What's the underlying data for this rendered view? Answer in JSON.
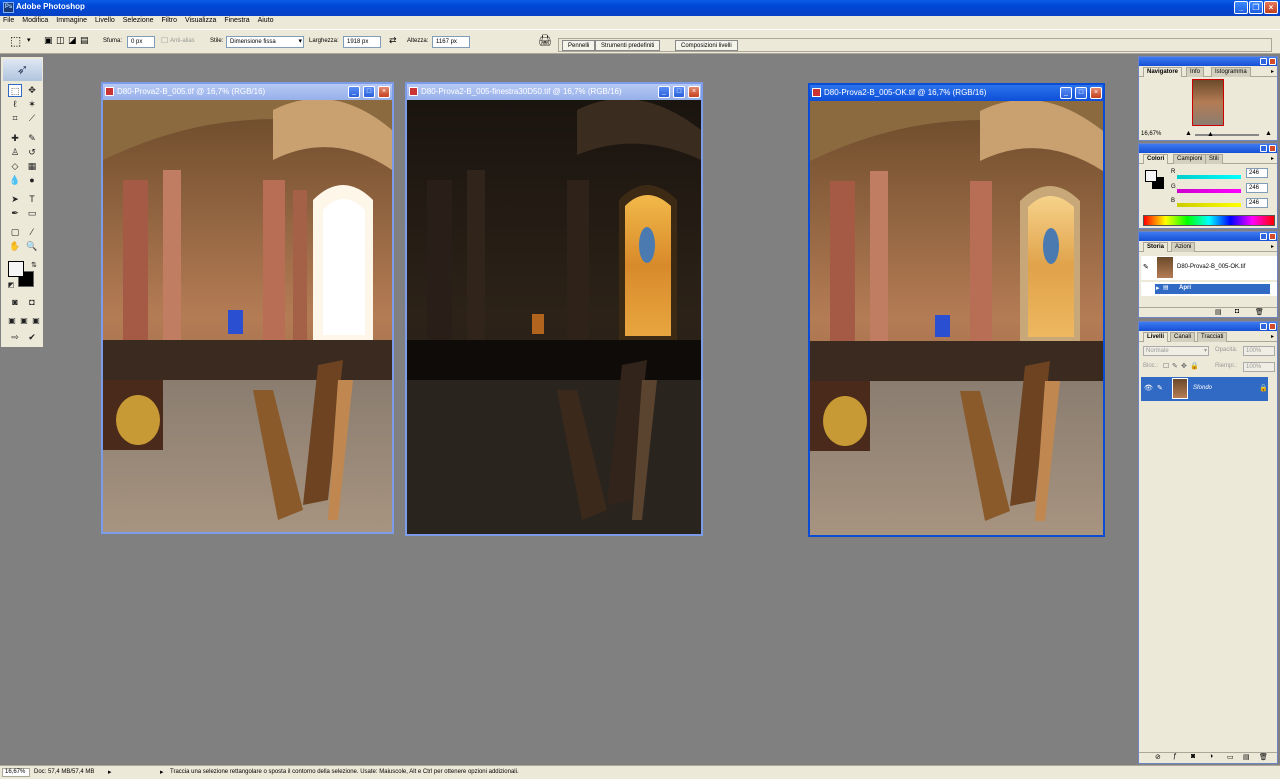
{
  "app": {
    "title": "Adobe Photoshop"
  },
  "menu": [
    "File",
    "Modifica",
    "Immagine",
    "Livello",
    "Selezione",
    "Filtro",
    "Visualizza",
    "Finestra",
    "Aiuto"
  ],
  "options": {
    "sfuma_label": "Sfuma:",
    "sfuma_value": "0 px",
    "antialias_label": "Anti-alias",
    "stile_label": "Stile:",
    "stile_value": "Dimensione fissa",
    "larghezza_label": "Larghezza:",
    "larghezza_value": "1918 px",
    "altezza_label": "Altezza:",
    "altezza_value": "1167 px",
    "palette_tabs": [
      "Pennelli",
      "Strumenti predefiniti",
      "Composizioni livelli"
    ]
  },
  "documents": [
    {
      "title": "D80-Prova2-B_005.tif @ 16,7% (RGB/16)",
      "variant": "bright",
      "active": false
    },
    {
      "title": "D80-Prova2-B_005-finestra30D50.tif @ 16,7% (RGB/16)",
      "variant": "dark",
      "active": false
    },
    {
      "title": "D80-Prova2-B_005-OK.tif @ 16,7% (RGB/16)",
      "variant": "ok",
      "active": true
    }
  ],
  "navigator": {
    "tabs": [
      "Navigatore",
      "Info",
      "Istogramma"
    ],
    "zoom": "16,67%"
  },
  "colors": {
    "tabs": [
      "Colori",
      "Campioni",
      "Stili"
    ],
    "channels": [
      {
        "label": "R",
        "value": "246",
        "color": "#19c9c9"
      },
      {
        "label": "G",
        "value": "246",
        "color": "#d637d6"
      },
      {
        "label": "B",
        "value": "246",
        "color": "#d4d41c"
      }
    ]
  },
  "history": {
    "tabs": [
      "Storia",
      "Azioni"
    ],
    "snapshot": "D80-Prova2-B_005-OK.tif",
    "step": "Apri"
  },
  "layers": {
    "tabs": [
      "Livelli",
      "Canali",
      "Tracciati"
    ],
    "blend_mode": "Normale",
    "opacity_label": "Opacità:",
    "opacity_value": "100%",
    "lock_label": "Bloc.:",
    "fill_label": "Riempi.:",
    "fill_value": "100%",
    "layer_name": "Sfondo"
  },
  "status": {
    "zoom": "16,67%",
    "doc": "Doc: 57,4 MB/57,4 MB",
    "hint": "Traccia una selezione rettangolare o sposta il contorno della selezione.  Usate: Maiuscole, Alt e Ctrl per ottenere opzioni addizionali."
  }
}
